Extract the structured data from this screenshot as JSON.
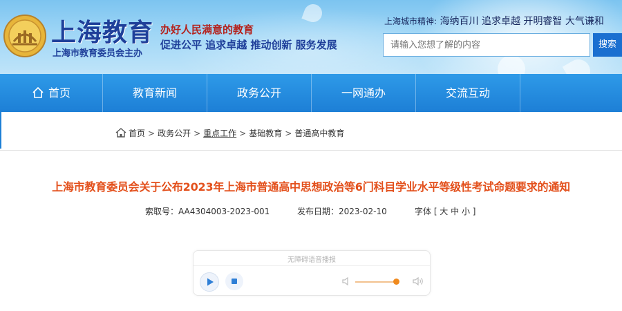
{
  "header": {
    "logo_text": "上海教育",
    "site_title": "上海教育",
    "site_subtitle": "上海市教育委员会主办",
    "slogan_line1": "办好人民满意的教育",
    "slogan_line2": "促进公平 追求卓越 推动创新 服务发展",
    "city_spirit_label": "上海城市精神:",
    "city_spirit": "海纳百川 追求卓越 开明睿智 大气谦和",
    "search_placeholder": "请输入您想了解的内容",
    "search_button": "搜索"
  },
  "nav": {
    "items": [
      "首页",
      "教育新闻",
      "政务公开",
      "一网通办",
      "交流互动"
    ]
  },
  "breadcrumb": {
    "items": [
      "首页",
      "政务公开",
      "重点工作",
      "基础教育",
      "普通高中教育"
    ],
    "separator": ">"
  },
  "article": {
    "title": "上海市教育委员会关于公布2023年上海市普通高中思想政治等6门科目学业水平等级性考试命题要求的通知",
    "index_no": "索取号：AA4304003-2023-001",
    "publish_date": "发布日期：2023-02-10",
    "font_size": "字体 [ 大 中 小 ]"
  },
  "player": {
    "caption": "无障碍语音播报",
    "volume": 0.85
  },
  "colors": {
    "nav_bg": "#1d7fd6",
    "title": "#e3501c",
    "brand_blue": "#1f3f9a",
    "accent_red": "#b4231e",
    "volume": "#f08a1e"
  },
  "icons": [
    "emblem-logo-icon",
    "home-icon",
    "play-icon",
    "stop-icon",
    "volume-low-icon",
    "volume-high-icon"
  ]
}
